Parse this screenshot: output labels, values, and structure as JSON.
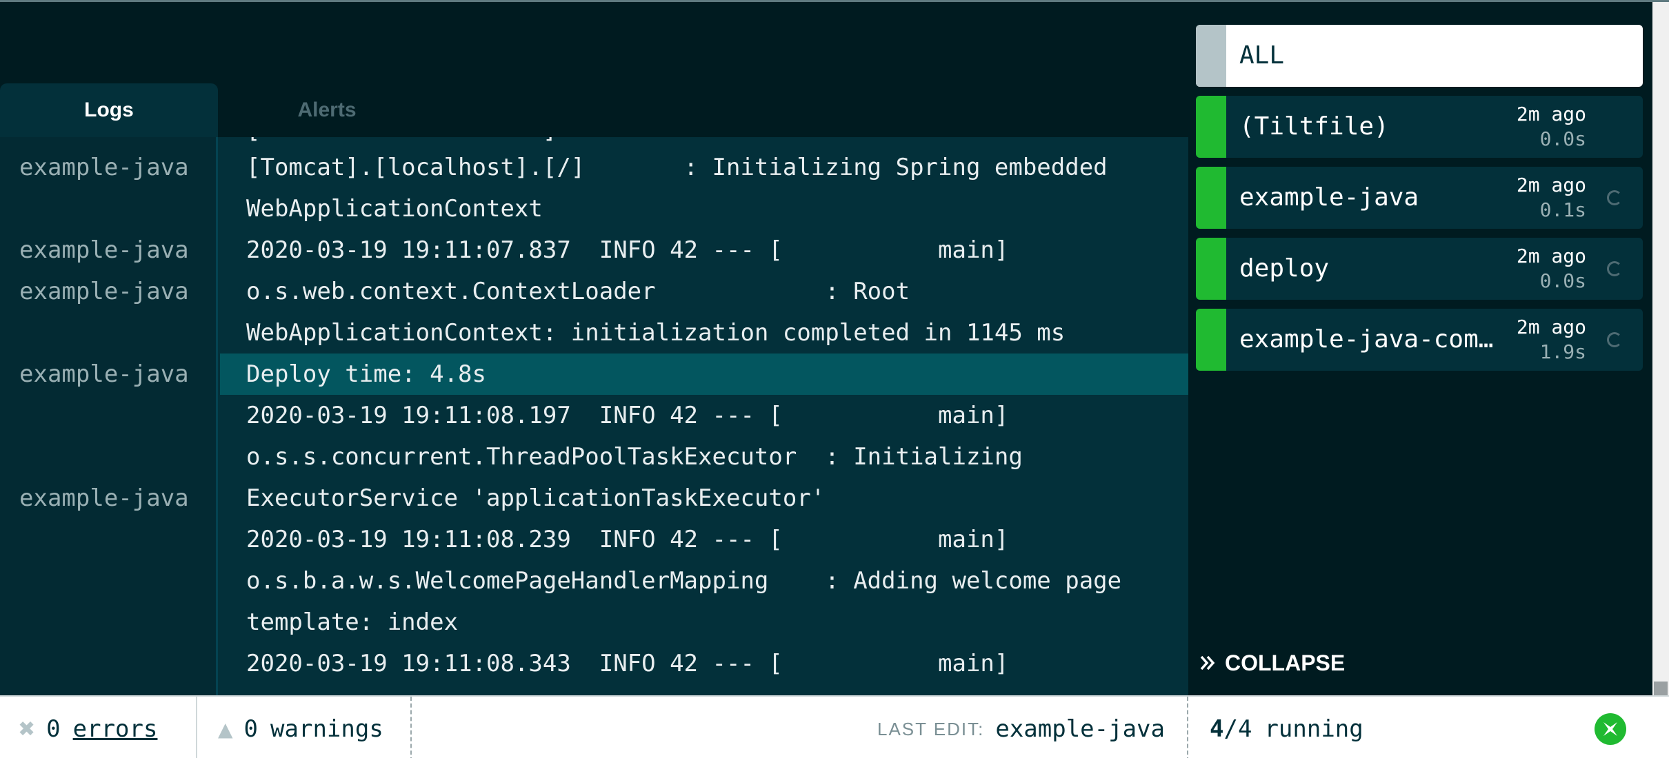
{
  "tabs": [
    {
      "label": "Logs",
      "active": true
    },
    {
      "label": "Alerts",
      "active": false
    }
  ],
  "log": {
    "cut_top": "[                    ]",
    "lines": [
      "[Tomcat].[localhost].[/]       : Initializing Spring embedded",
      "WebApplicationContext",
      "2020-03-19 19:11:07.837  INFO 42 --- [           main]",
      "o.s.web.context.ContextLoader            : Root",
      "WebApplicationContext: initialization completed in 1145 ms",
      "Deploy time: 4.8s",
      "2020-03-19 19:11:08.197  INFO 42 --- [           main]",
      "o.s.s.concurrent.ThreadPoolTaskExecutor  : Initializing",
      "ExecutorService 'applicationTaskExecutor'",
      "2020-03-19 19:11:08.239  INFO 42 --- [           main]",
      "o.s.b.a.w.s.WelcomePageHandlerMapping    : Adding welcome page",
      "template: index",
      "2020-03-19 19:11:08.343  INFO 42 --- [           main]"
    ],
    "prefixes": [
      "example-java",
      "example-java",
      "example-java",
      "example-java",
      "example-java"
    ]
  },
  "sidebar": {
    "all_label": "ALL",
    "resources": [
      {
        "name": "(Tiltfile)",
        "ago": "2m ago",
        "duration": "0.0s",
        "status": "ok"
      },
      {
        "name": "example-java",
        "ago": "2m ago",
        "duration": "0.1s",
        "status": "ok"
      },
      {
        "name": "deploy",
        "ago": "2m ago",
        "duration": "0.0s",
        "status": "ok"
      },
      {
        "name": "example-java-compile",
        "ago": "2m ago",
        "duration": "1.9s",
        "status": "ok"
      }
    ],
    "collapse_label": "COLLAPSE"
  },
  "statusbar": {
    "errors_count": "0",
    "errors_label": "errors",
    "warnings_count": "0",
    "warnings_label": "warnings",
    "last_edit_label": "LAST EDIT:",
    "last_edit_value": "example-java",
    "running_current": "4",
    "running_total": "/4",
    "running_label": "running"
  },
  "colors": {
    "background": "#001b20",
    "pane": "#03303a",
    "highlight": "#03565f",
    "status_ok": "#20ba31"
  },
  "icons": {
    "error": "x-icon",
    "warning": "triangle-icon",
    "collapse": "double-chevron-right-icon",
    "pending": "spinner-icon",
    "logo": "tilt-logo-icon"
  }
}
